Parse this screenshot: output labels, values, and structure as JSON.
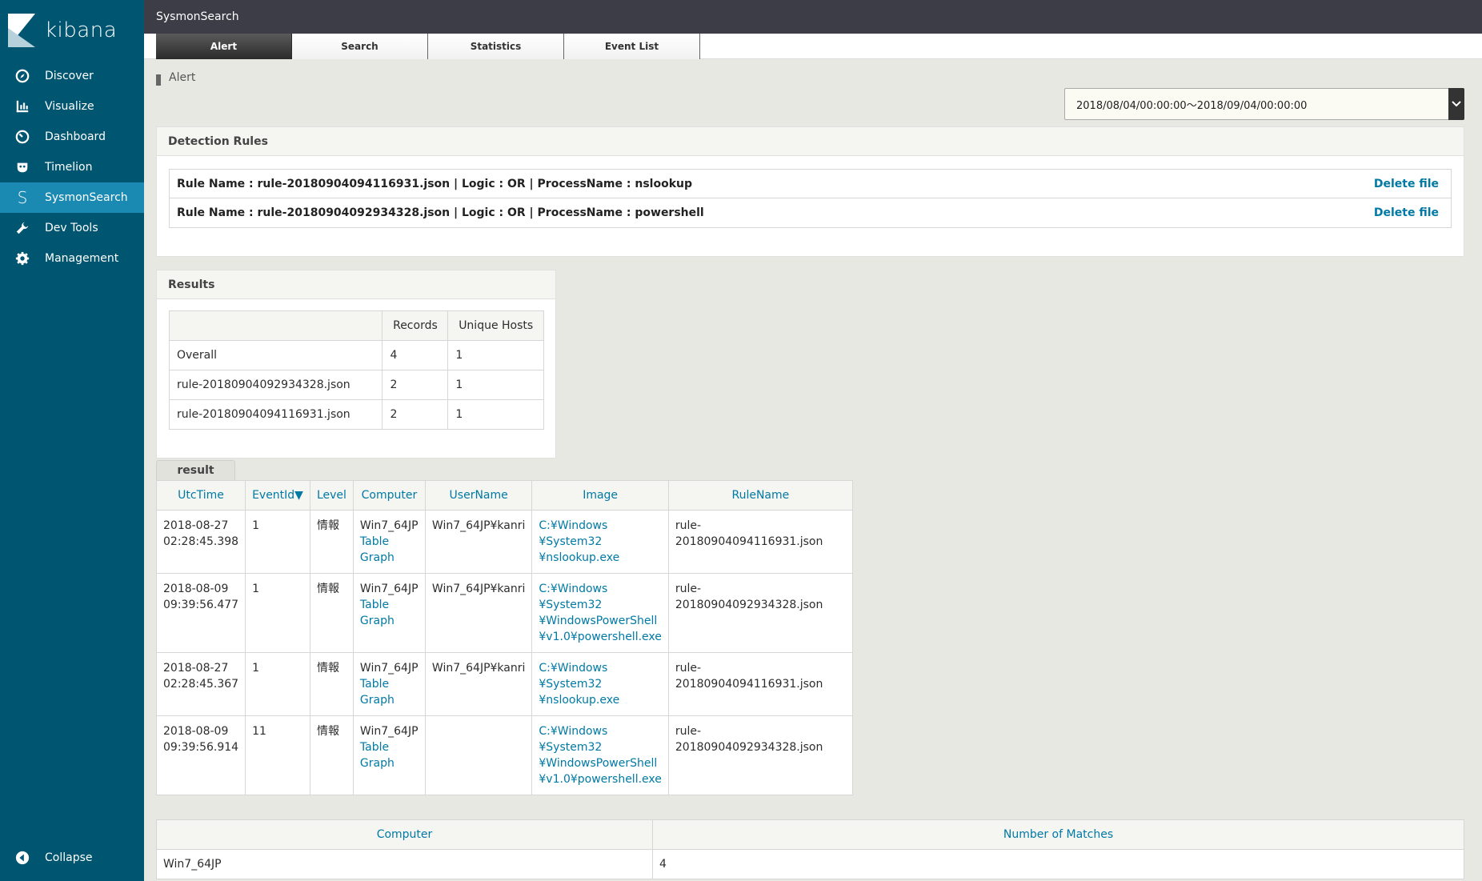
{
  "app": {
    "brand": "kibana",
    "page_title": "SysmonSearch"
  },
  "sidebar": {
    "items": [
      {
        "label": "Discover",
        "icon": "compass-icon"
      },
      {
        "label": "Visualize",
        "icon": "bar-chart-icon"
      },
      {
        "label": "Dashboard",
        "icon": "dashboard-icon"
      },
      {
        "label": "Timelion",
        "icon": "timelion-icon"
      },
      {
        "label": "SysmonSearch",
        "icon": "s-letter-icon",
        "active": true
      },
      {
        "label": "Dev Tools",
        "icon": "wrench-icon"
      },
      {
        "label": "Management",
        "icon": "gear-icon"
      }
    ],
    "collapse_label": "Collapse"
  },
  "tabs": [
    {
      "label": "Alert",
      "active": true
    },
    {
      "label": "Search"
    },
    {
      "label": "Statistics"
    },
    {
      "label": "Event List"
    }
  ],
  "breadcrumb": "Alert",
  "date_range": "2018/08/04/00:00:00〜2018/09/04/00:00:00",
  "detection_rules": {
    "title": "Detection Rules",
    "rules": [
      {
        "text": "Rule Name : rule-20180904094116931.json | Logic : OR | ProcessName : nslookup",
        "action": "Delete file"
      },
      {
        "text": "Rule Name : rule-20180904092934328.json | Logic : OR | ProcessName : powershell",
        "action": "Delete file"
      }
    ]
  },
  "results": {
    "title": "Results",
    "columns": [
      "",
      "Records",
      "Unique Hosts"
    ],
    "rows": [
      [
        "Overall",
        "4",
        "1"
      ],
      [
        "rule-20180904092934328.json",
        "2",
        "1"
      ],
      [
        "rule-20180904094116931.json",
        "2",
        "1"
      ]
    ]
  },
  "events": {
    "tab_label": "result",
    "columns": [
      "UtcTime",
      "EventId▼",
      "Level",
      "Computer",
      "UserName",
      "Image",
      "RuleName"
    ],
    "rows": [
      {
        "time1": "2018-08-27",
        "time2": "02:28:45.398",
        "event_id": "1",
        "level": "情報",
        "computer": "Win7_64JP",
        "table": "Table",
        "graph": "Graph",
        "user": "Win7_64JP¥kanri",
        "image": [
          "C:¥Windows",
          "¥System32",
          "¥nslookup.exe"
        ],
        "rule": "rule-20180904094116931.json"
      },
      {
        "time1": "2018-08-09",
        "time2": "09:39:56.477",
        "event_id": "1",
        "level": "情報",
        "computer": "Win7_64JP",
        "table": "Table",
        "graph": "Graph",
        "user": "Win7_64JP¥kanri",
        "image": [
          "C:¥Windows",
          "¥System32",
          "¥WindowsPowerShell",
          "¥v1.0¥powershell.exe"
        ],
        "rule": "rule-20180904092934328.json"
      },
      {
        "time1": "2018-08-27",
        "time2": "02:28:45.367",
        "event_id": "1",
        "level": "情報",
        "computer": "Win7_64JP",
        "table": "Table",
        "graph": "Graph",
        "user": "Win7_64JP¥kanri",
        "image": [
          "C:¥Windows",
          "¥System32",
          "¥nslookup.exe"
        ],
        "rule": "rule-20180904094116931.json"
      },
      {
        "time1": "2018-08-09",
        "time2": "09:39:56.914",
        "event_id": "11",
        "level": "情報",
        "computer": "Win7_64JP",
        "table": "Table",
        "graph": "Graph",
        "user": "",
        "image": [
          "C:¥Windows",
          "¥System32",
          "¥WindowsPowerShell",
          "¥v1.0¥powershell.exe"
        ],
        "rule": "rule-20180904092934328.json"
      }
    ]
  },
  "matches": {
    "columns": [
      "Computer",
      "Number of Matches"
    ],
    "rows": [
      [
        "Win7_64JP",
        "4"
      ]
    ]
  },
  "colors": {
    "sidebar": "#005571",
    "sidebar_active": "#1a8ab3",
    "topbar": "#3d3d48",
    "link": "#0079a5"
  }
}
